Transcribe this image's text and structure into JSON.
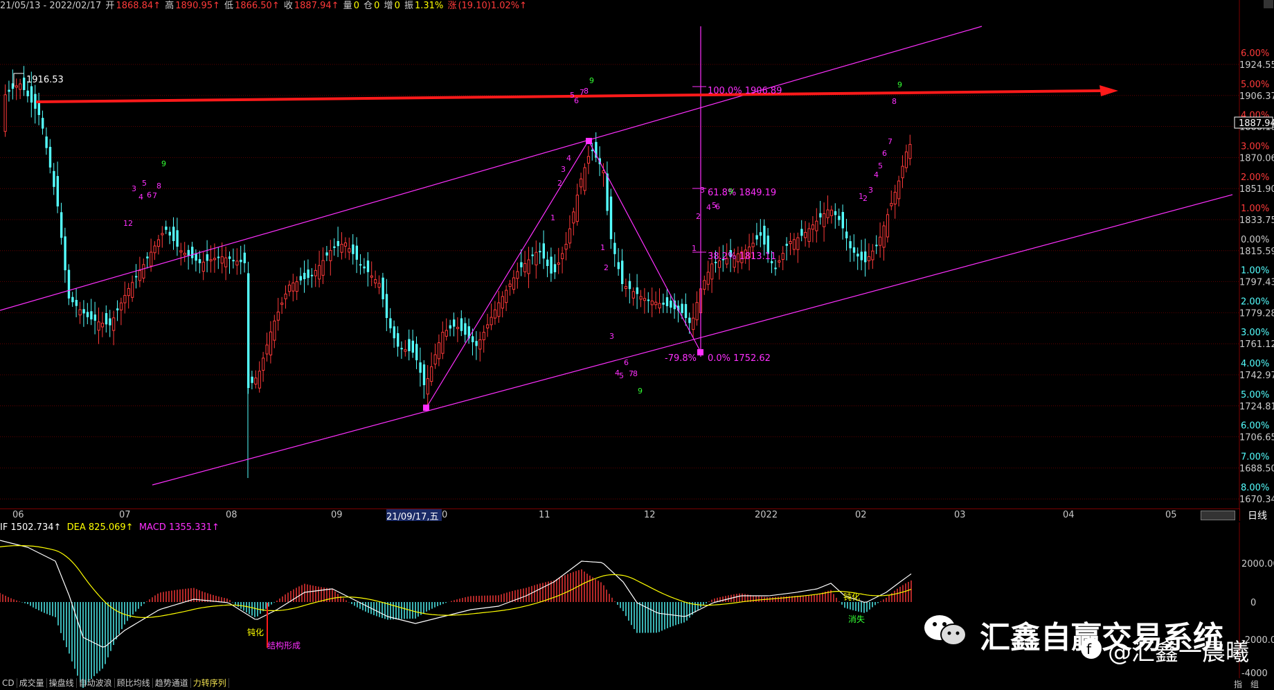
{
  "colors": {
    "up": "#ff3a3a",
    "down": "#54ffff",
    "magenta": "#ff30ff",
    "green": "#33ff33",
    "trend_arrow": "#ff1a1a",
    "grid": "#7a0000",
    "dif": "#ffffff",
    "dea": "#ffff00",
    "macd_label": "#ff30ff",
    "highlight_bg": "#1a2a66"
  },
  "infobar": {
    "date_range": "21/05/13 - 2022/02/17",
    "open_label": "开",
    "open": "1868.84↑",
    "high_label": "高",
    "high": "1890.95↑",
    "low_label": "低",
    "low": "1866.50↑",
    "close_label": "收",
    "close": "1887.94↑",
    "vol_label": "量",
    "vol": "0",
    "oi_label": "仓",
    "oi": "0",
    "inc_label": "增",
    "inc": "0",
    "amp_label": "振",
    "amp": "1.31%",
    "chg_label": "涨",
    "chg": "(19.10)1.02%↑"
  },
  "price_axis": {
    "prices": [
      "1924.55",
      "1906.37",
      "1888.19",
      "1870.06",
      "1851.90",
      "1833.75",
      "1815.59",
      "1797.43",
      "1779.28",
      "1761.12",
      "1742.97",
      "1724.81",
      "1706.65",
      "1688.50",
      "1670.34"
    ],
    "percents": [
      "6.00%",
      "5.00%",
      "4.00%",
      "3.00%",
      "2.00%",
      "1.00%",
      "0.00%",
      "1.00%",
      "2.00%",
      "3.00%",
      "4.00%",
      "5.00%",
      "6.00%",
      "7.00%",
      "8.00%"
    ],
    "current_price": "1887.94"
  },
  "annotations": {
    "peak_label": "1916.53",
    "fib_100": "100.0% 1906.89",
    "fib_618": "61.8% 1849.19",
    "fib_382": "38.2% 1813.11",
    "fib_0": "0.0% 1752.62",
    "fib_neg": "-79.8%",
    "nums_magenta_1": [
      "3",
      "4",
      "5",
      "6",
      "7",
      "8",
      "12"
    ],
    "nums_green": [
      "9",
      "9",
      "9",
      "9",
      "9"
    ],
    "seq_top": [
      "5",
      "6",
      "7",
      "8"
    ],
    "seq_right": [
      "1",
      "2",
      "3",
      "4",
      "5",
      "6",
      "7",
      "8"
    ]
  },
  "date_axis": {
    "labels": [
      "06",
      "07",
      "08",
      "09",
      "0",
      "11",
      "12",
      "2022",
      "02",
      "03",
      "04",
      "05"
    ],
    "highlight": "21/09/17,五",
    "period": "日线"
  },
  "macd": {
    "dif_label": "IF",
    "dif": "1502.734↑",
    "dea_label": "DEA",
    "dea": "825.069↑",
    "macd_label": "MACD",
    "macd": "1355.331↑",
    "axis": [
      "2000.00",
      "0",
      "-2000.00",
      "-4000"
    ],
    "note_dunhua_1": "钝化",
    "note_struct": "结构形成",
    "note_dunhua_2": "钝化",
    "note_xiaoshi": "消失"
  },
  "bottom_tabs": [
    "CD",
    "成交量",
    "操盘线",
    "自动波浪",
    "顾比均线",
    "趋势通道",
    "力转序列"
  ],
  "bottom_right": [
    "指",
    "组"
  ],
  "watermark": {
    "title": "汇鑫自赢交易系统",
    "sub": "@汇鑫一晨曦"
  }
}
